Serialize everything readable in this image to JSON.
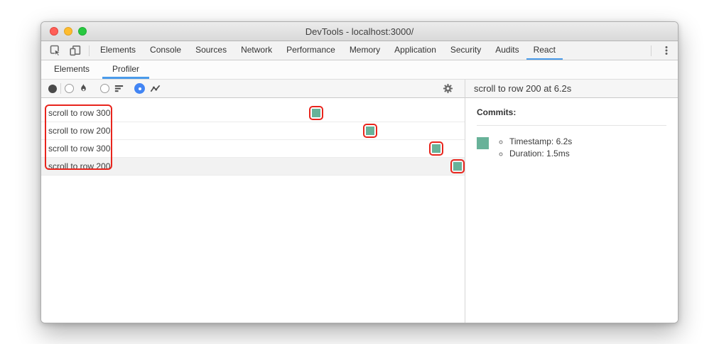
{
  "window": {
    "title": "DevTools - localhost:3000/"
  },
  "devtools_tabs": {
    "items": [
      {
        "label": "Elements"
      },
      {
        "label": "Console"
      },
      {
        "label": "Sources"
      },
      {
        "label": "Network"
      },
      {
        "label": "Performance"
      },
      {
        "label": "Memory"
      },
      {
        "label": "Application"
      },
      {
        "label": "Security"
      },
      {
        "label": "Audits"
      },
      {
        "label": "React"
      }
    ],
    "selected": "React"
  },
  "react_tabs": {
    "items": [
      {
        "label": "Elements"
      },
      {
        "label": "Profiler"
      }
    ],
    "selected": "Profiler"
  },
  "profiler": {
    "interactions": [
      {
        "label": "scroll to row 300"
      },
      {
        "label": "scroll to row 200"
      },
      {
        "label": "scroll to row 300"
      },
      {
        "label": "scroll to row 200",
        "selected": true
      }
    ]
  },
  "details": {
    "header": "scroll to row 200 at 6.2s",
    "commits_heading": "Commits:",
    "commit": {
      "timestamp": "Timestamp: 6.2s",
      "duration": "Duration: 1.5ms"
    }
  },
  "colors": {
    "accent_blue": "#4a9bea",
    "radio_blue": "#4285f4",
    "commit_teal": "#68b299",
    "highlight_red": "#e8251d",
    "selected_row_bg": "#f2f2f2"
  }
}
